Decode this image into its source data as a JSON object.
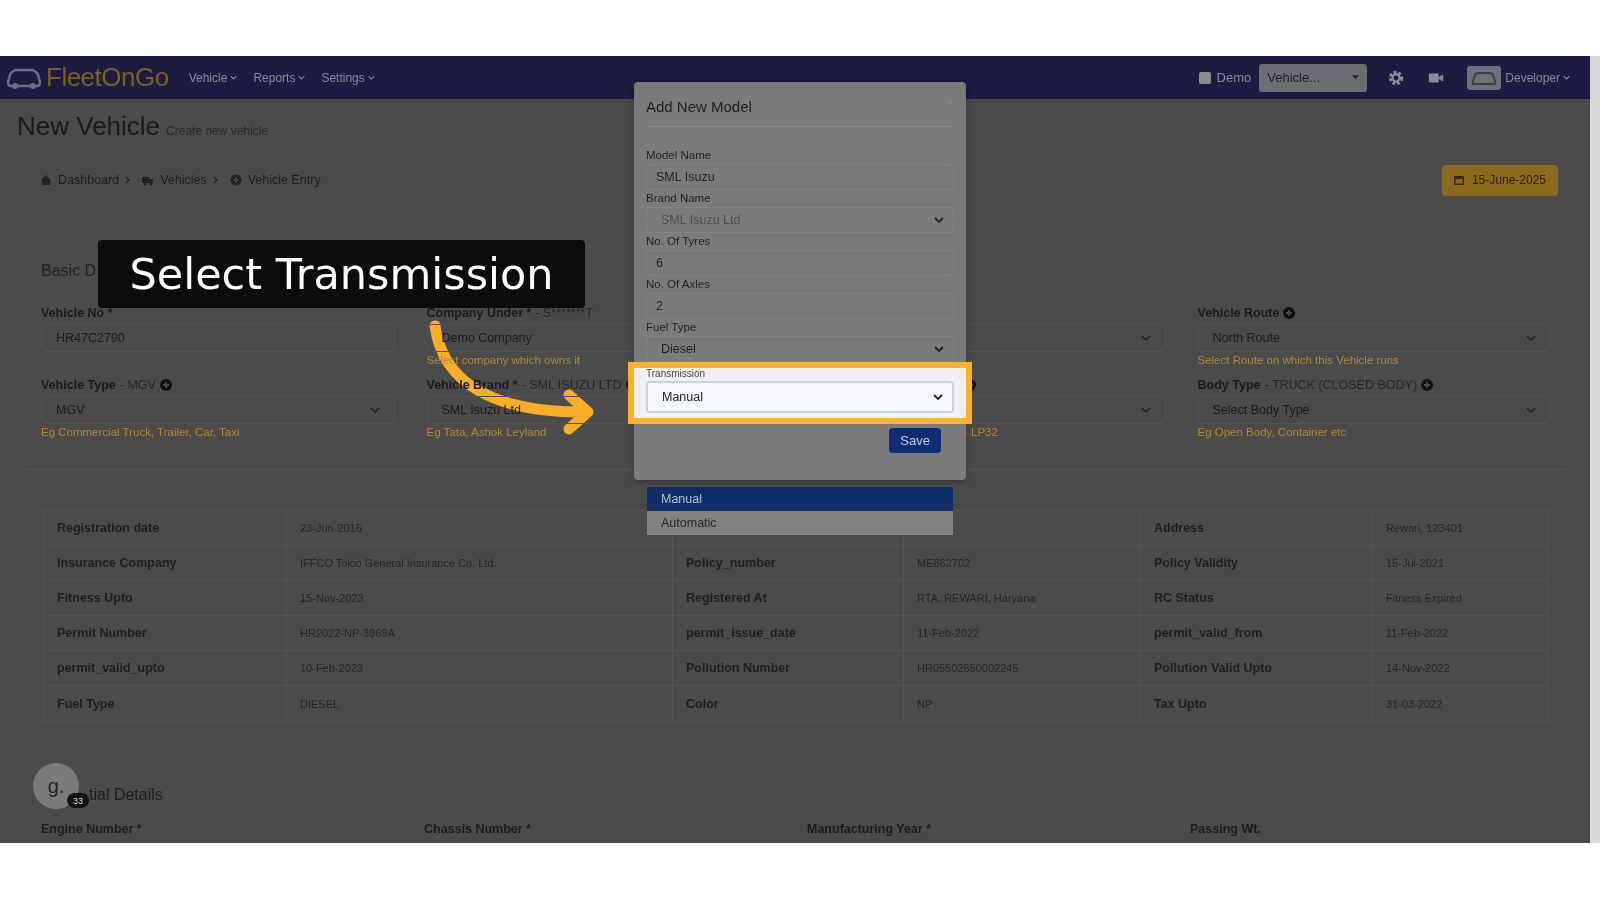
{
  "nav": {
    "brand": "FleetOnGo",
    "menus": [
      {
        "label": "Vehicle"
      },
      {
        "label": "Reports"
      },
      {
        "label": "Settings"
      }
    ],
    "demo": {
      "label": "Demo",
      "checked": false
    },
    "vehicle_select": {
      "value": "Vehicle..."
    },
    "user": {
      "name": "Developer"
    }
  },
  "page": {
    "title": "New Vehicle",
    "subtitle": "Create new vehicle",
    "breadcrumbs": [
      "Dashboard",
      "Vehicles",
      "Vehicle Entry"
    ],
    "date": "15-June-2025"
  },
  "basic": {
    "heading": "Basic D",
    "rows": [
      [
        {
          "kind": "input",
          "label": "Vehicle No *",
          "value": "HR47C2790"
        },
        {
          "kind": "input",
          "label": "Company Under *",
          "extra": "- S*******T",
          "value": "Demo Company",
          "help": "Select company which owns it"
        },
        {
          "kind": "select"
        },
        {
          "kind": "select",
          "label": "Vehicle Route",
          "add": true,
          "value": "North Route",
          "help": "Select Route on which this Vehicle runs"
        }
      ],
      [
        {
          "kind": "select",
          "label": "Vehicle Type",
          "extra": "- MGV",
          "add": true,
          "value": "MGV",
          "help": "Eg Commercial Truck, Trailer, Car, Taxi"
        },
        {
          "kind": "select",
          "label": "Vehicle Brand *",
          "extra": "- SML ISUZU LTD",
          "add": true,
          "value": "SML Isuzu Ltd",
          "help": "Eg Tata, Ashok Leyland"
        },
        {
          "kind": "select",
          "add": true,
          "help": "- LP32"
        },
        {
          "kind": "select",
          "label": "Body Type",
          "extra": "- TRUCK (CLOSED BODY)",
          "add": true,
          "placeholder": "Select Body Type",
          "help": "Eg Open Body, Container etc"
        }
      ]
    ]
  },
  "details": {
    "rows": [
      {
        "left": {
          "label": "Registration date",
          "value": "23-Jun-2016"
        },
        "right": {
          "label": "Address",
          "value": "Rewari, 123401"
        }
      },
      {
        "left": {
          "label": "Insurance Company",
          "value": "IFFCO Tokio General Insurance Co. Ltd."
        },
        "middle": {
          "label": "Policy_number",
          "value": "ME862702"
        },
        "right": {
          "label": "Policy Validity",
          "value": "15-Jul-2021"
        }
      },
      {
        "left": {
          "label": "Fitness Upto",
          "value": "15-Nov-2023"
        },
        "middle": {
          "label": "Registered At",
          "value": "RTA, REWARI, Haryana"
        },
        "right": {
          "label": "RC Status",
          "value": "Fitness Expired"
        }
      },
      {
        "left": {
          "label": "Permit Number",
          "value": "HR2022-NP-3969A"
        },
        "middle": {
          "label": "permit_issue_date",
          "value": "11-Feb-2022"
        },
        "right": {
          "label": "permit_valid_from",
          "value": "11-Feb-2022"
        }
      },
      {
        "left": {
          "label": "permit_valid_upto",
          "value": "10-Feb-2023"
        },
        "middle": {
          "label": "Pollution Number",
          "value": "HR05502650002245"
        },
        "right": {
          "label": "Pollution Valid Upto",
          "value": "14-Nov-2022"
        }
      },
      {
        "left": {
          "label": "Fuel Type",
          "value": "DIESEL"
        },
        "middle": {
          "label": "Color",
          "value": "NP"
        },
        "right": {
          "label": "Tax Upto",
          "value": "31-03-2022"
        }
      }
    ]
  },
  "essential": {
    "heading": "tial Details",
    "labels": [
      "Engine Number *",
      "Chassis Number *",
      "Manufacturing Year *",
      "Passing Wt."
    ]
  },
  "modal": {
    "title": "Add New Model",
    "fields": [
      {
        "kind": "input",
        "label": "Model Name",
        "value": "SML Isuzu",
        "disabled": false,
        "highlighted": false
      },
      {
        "kind": "select",
        "label": "Brand Name",
        "value": "SML Isuzu Ltd",
        "disabled": true,
        "highlighted": false
      },
      {
        "kind": "input",
        "label": "No. Of Tyres",
        "value": "6",
        "disabled": false,
        "highlighted": false
      },
      {
        "kind": "input",
        "label": "No. Of Axles",
        "value": "2",
        "disabled": false,
        "highlighted": false
      },
      {
        "kind": "select",
        "label": "Fuel Type",
        "value": "Diesel",
        "disabled": false,
        "highlighted": false
      },
      {
        "kind": "select",
        "label": "Transmission",
        "value": "Manual",
        "disabled": false,
        "highlighted": true
      }
    ],
    "save": "Save",
    "options": [
      {
        "label": "Manual",
        "selected": true
      },
      {
        "label": "Automatic",
        "selected": false
      }
    ]
  },
  "callout": {
    "text": "Select Transmission"
  },
  "guide": {
    "initial": "g.",
    "badge": "33"
  }
}
